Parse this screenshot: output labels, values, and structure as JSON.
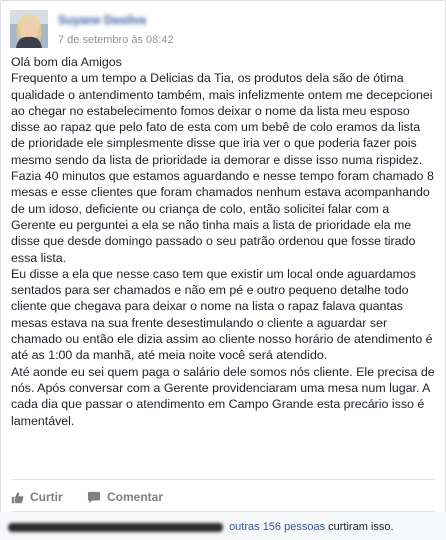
{
  "post": {
    "author_name": "Suyane Dasilva",
    "timestamp": "7 de setembro às 08:42",
    "body": "Olá bom dia Amigos\nFrequento a um tempo a Delicias da Tia, os produtos dela são de ótima qualidade o antendimento também, mais infelizmente ontem me decepcionei ao chegar no estabelecimento fomos deixar o nome da lista meu esposo disse ao rapaz que pelo fato de esta com um bebê de colo eramos da lista de prioridade ele simplesmente disse que iria ver o que poderia fazer pois mesmo sendo da lista de prioridade ia demorar e disse isso numa rispidez.\nFazia 40 minutos que estamos aguardando e nesse tempo foram chamado 8 mesas e esse clientes que foram chamados nenhum estava acompanhando de um idoso, deficiente ou criança de colo, então solicitei falar com a Gerente eu perguntei a ela se não tinha mais a lista de prioridade ela me disse que desde domingo passado o seu patrão ordenou que fosse tirado essa lista.\nEu disse a ela que nesse caso tem que existir um local onde aguardamos sentados para ser chamados e não em pé e outro pequeno detalhe todo cliente que chegava para deixar o nome na lista o rapaz falava quantas mesas estava na sua frente desestimulando o cliente a aguardar ser chamado ou então ele dizia assim ao cliente nosso horário de atendimento é até as 1:00 da manhã, até meia noite você será atendido.\nAté aonde eu sei quem paga o salário dele somos nós cliente. Ele precisa de nós. Após conversar com a Gerente providenciaram uma mesa num lugar. A cada dia que passar o atendimento em Campo Grande esta precário isso é lamentável."
  },
  "actions": {
    "like_label": "Curtir",
    "comment_label": "Comentar",
    "like_icon": "thumbs-up-icon",
    "comment_icon": "speech-bubble-icon"
  },
  "likes": {
    "others_link": "outras 156 pessoas",
    "suffix": "curtiram isso."
  },
  "colors": {
    "link": "#365899",
    "meta": "#90949c",
    "action": "#7f7f7f",
    "footer_bg": "#f6f7f9"
  }
}
